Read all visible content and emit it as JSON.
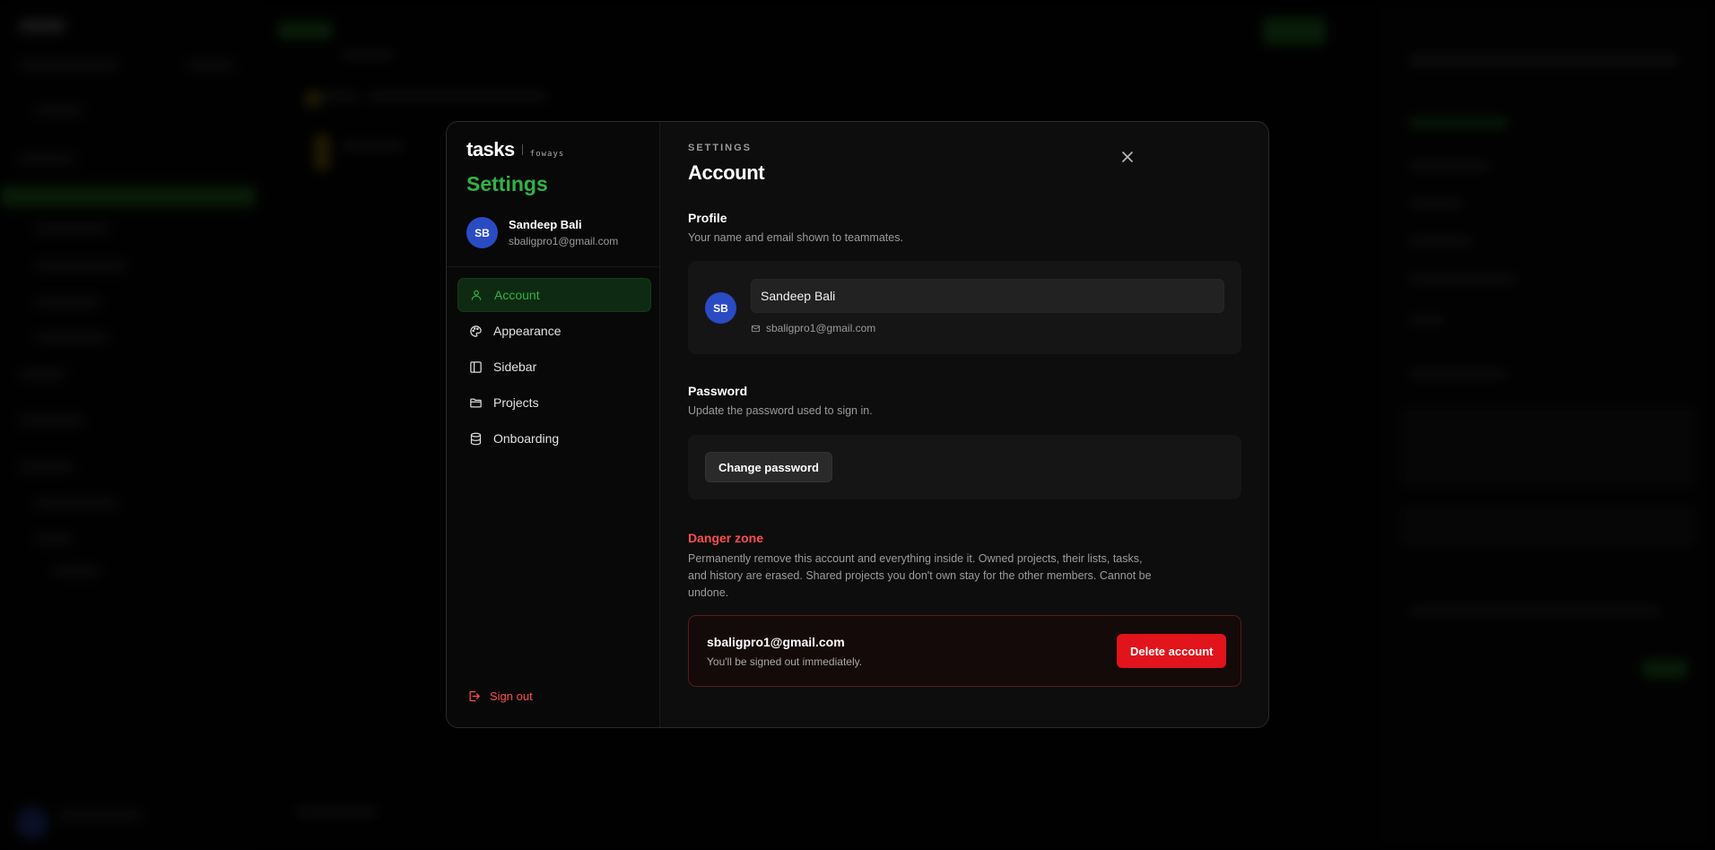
{
  "brand": {
    "name": "tasks",
    "sub": "foways"
  },
  "sidebar": {
    "title": "Settings",
    "user": {
      "initials": "SB",
      "name": "Sandeep Bali",
      "email": "sbaligpro1@gmail.com"
    },
    "items": [
      {
        "label": "Account",
        "icon": "user-icon",
        "active": true
      },
      {
        "label": "Appearance",
        "icon": "palette-icon",
        "active": false
      },
      {
        "label": "Sidebar",
        "icon": "sidebar-panel-icon",
        "active": false
      },
      {
        "label": "Projects",
        "icon": "folder-icon",
        "active": false
      },
      {
        "label": "Onboarding",
        "icon": "database-icon",
        "active": false
      }
    ],
    "signout_label": "Sign out"
  },
  "main": {
    "eyebrow": "SETTINGS",
    "title": "Account",
    "profile": {
      "title": "Profile",
      "description": "Your name and email shown to teammates.",
      "initials": "SB",
      "name_value": "Sandeep Bali",
      "email": "sbaligpro1@gmail.com"
    },
    "password": {
      "title": "Password",
      "description": "Update the password used to sign in.",
      "button_label": "Change password"
    },
    "danger": {
      "title": "Danger zone",
      "description": "Permanently remove this account and everything inside it. Owned projects, their lists, tasks, and history are erased. Shared projects you don't own stay for the other members. Cannot be undone.",
      "email": "sbaligpro1@gmail.com",
      "note": "You'll be signed out immediately.",
      "button_label": "Delete account"
    }
  },
  "colors": {
    "accent": "#2fb344",
    "danger": "#e0141a",
    "avatar": "#2a4bc4"
  }
}
